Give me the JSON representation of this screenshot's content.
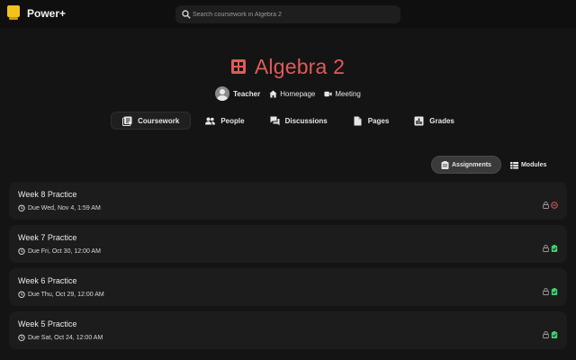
{
  "app": {
    "brand": "Power+"
  },
  "search": {
    "placeholder": "Search coursework in Algebra 2"
  },
  "course": {
    "title": "Algebra 2",
    "teacher_label": "Teacher",
    "homepage_label": "Homepage",
    "meeting_label": "Meeting"
  },
  "tabs": [
    {
      "label": "Coursework",
      "icon": "coursework-icon",
      "active": true
    },
    {
      "label": "People",
      "icon": "people-icon"
    },
    {
      "label": "Discussions",
      "icon": "discussions-icon"
    },
    {
      "label": "Pages",
      "icon": "pages-icon"
    },
    {
      "label": "Grades",
      "icon": "grades-icon"
    }
  ],
  "view_toggle": {
    "assignments_label": "Assignments",
    "modules_label": "Modules",
    "active": "assignments"
  },
  "assignments": [
    {
      "title": "Week 8 Practice",
      "due": "Due Wed, Nov 4, 1:59 AM",
      "status": "missing"
    },
    {
      "title": "Week 7 Practice",
      "due": "Due Fri, Oct 30, 12:00 AM",
      "status": "submitted"
    },
    {
      "title": "Week 6 Practice",
      "due": "Due Thu, Oct 29, 12:00 AM",
      "status": "submitted"
    },
    {
      "title": "Week 5 Practice",
      "due": "Due Sat, Oct 24, 12:00 AM",
      "status": "submitted"
    }
  ],
  "colors": {
    "accent": "#e05a5a",
    "submitted": "#3ecf6e",
    "missing": "#e05a5a",
    "background": "#141414",
    "card": "#1c1c1c"
  }
}
